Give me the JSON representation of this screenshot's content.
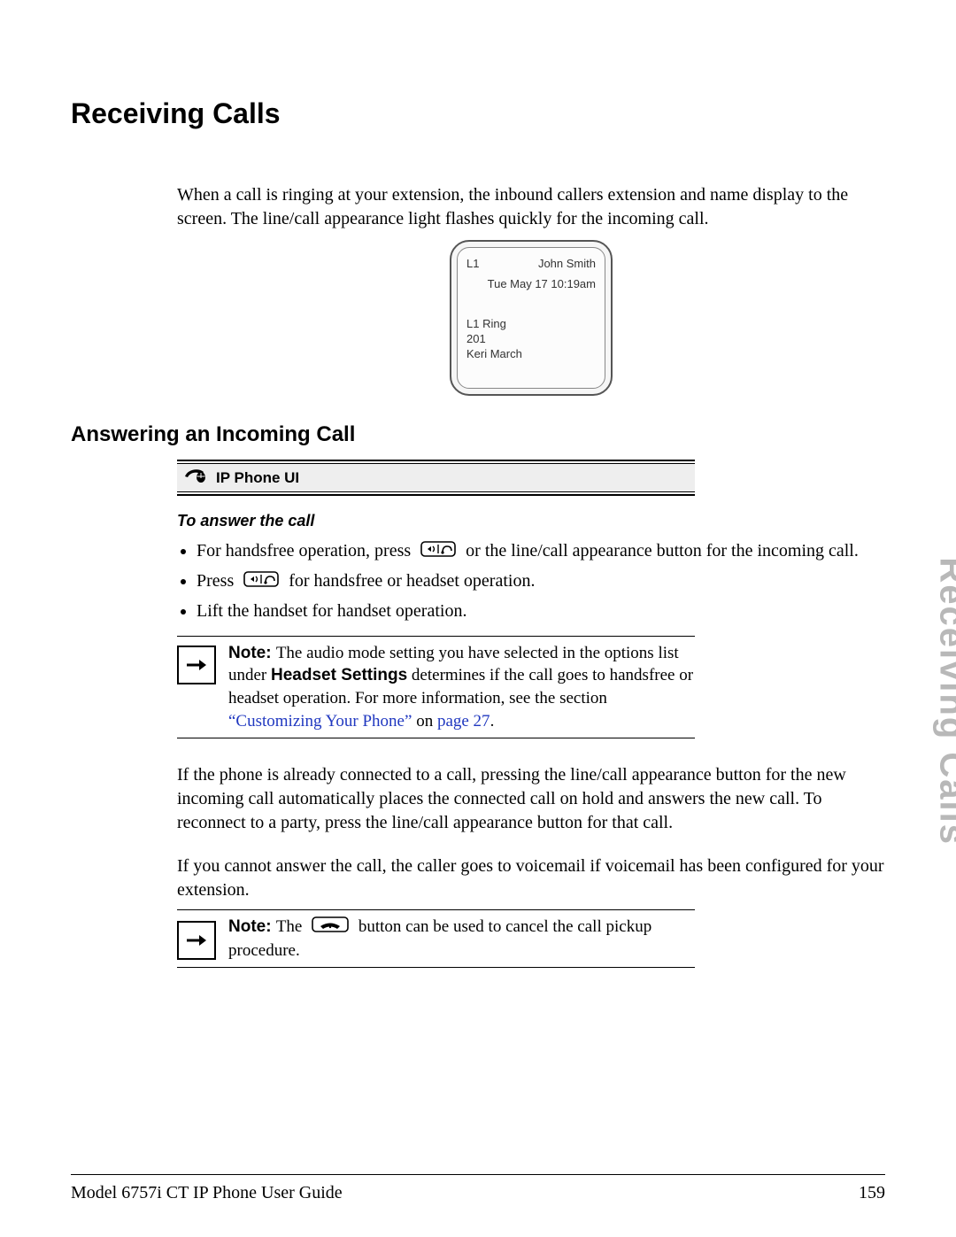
{
  "side_tab": "Receiving Calls",
  "title": "Receiving Calls",
  "intro": "When a call is ringing at your extension, the inbound callers extension and name display to the screen. The line/call appearance light flashes quickly for the incoming call.",
  "phone": {
    "line": "L1",
    "name": "John Smith",
    "datetime": "Tue May 17 10:19am",
    "status1": "L1 Ring",
    "status2": "201",
    "status3": "Keri March"
  },
  "section2": "Answering an Incoming Call",
  "ui_banner": "IP Phone UI",
  "subhead": "To answer the call",
  "bullets": {
    "b1_a": "For handsfree operation, press ",
    "b1_b": " or the line/call appearance button for the incoming call.",
    "b2_a": "Press ",
    "b2_b": " for handsfree or headset operation.",
    "b3": "Lift the handset for handset operation."
  },
  "note1": {
    "label": "Note: ",
    "t1": "The audio mode setting you have selected in the options list under ",
    "bold1": "Headset Settings",
    "t2": " determines if the call goes to handsfree or headset operation. For more information, see the section ",
    "link1": "“Customizing Your Phone”",
    "t3": " on ",
    "link2": "page 27",
    "t4": "."
  },
  "para2": "If the phone is already connected to a call, pressing the line/call appearance button for the new incoming call automatically places the connected call on hold and answers the new call. To reconnect to a party, press the line/call appearance button for that call.",
  "para3": "If you cannot answer the call, the caller goes to voicemail if voicemail has been configured for your extension.",
  "note2": {
    "label": "Note: ",
    "t1": "The ",
    "t2": " button can be used to cancel the call pickup procedure."
  },
  "footer_left": "Model 6757i CT IP Phone User Guide",
  "footer_right": "159"
}
